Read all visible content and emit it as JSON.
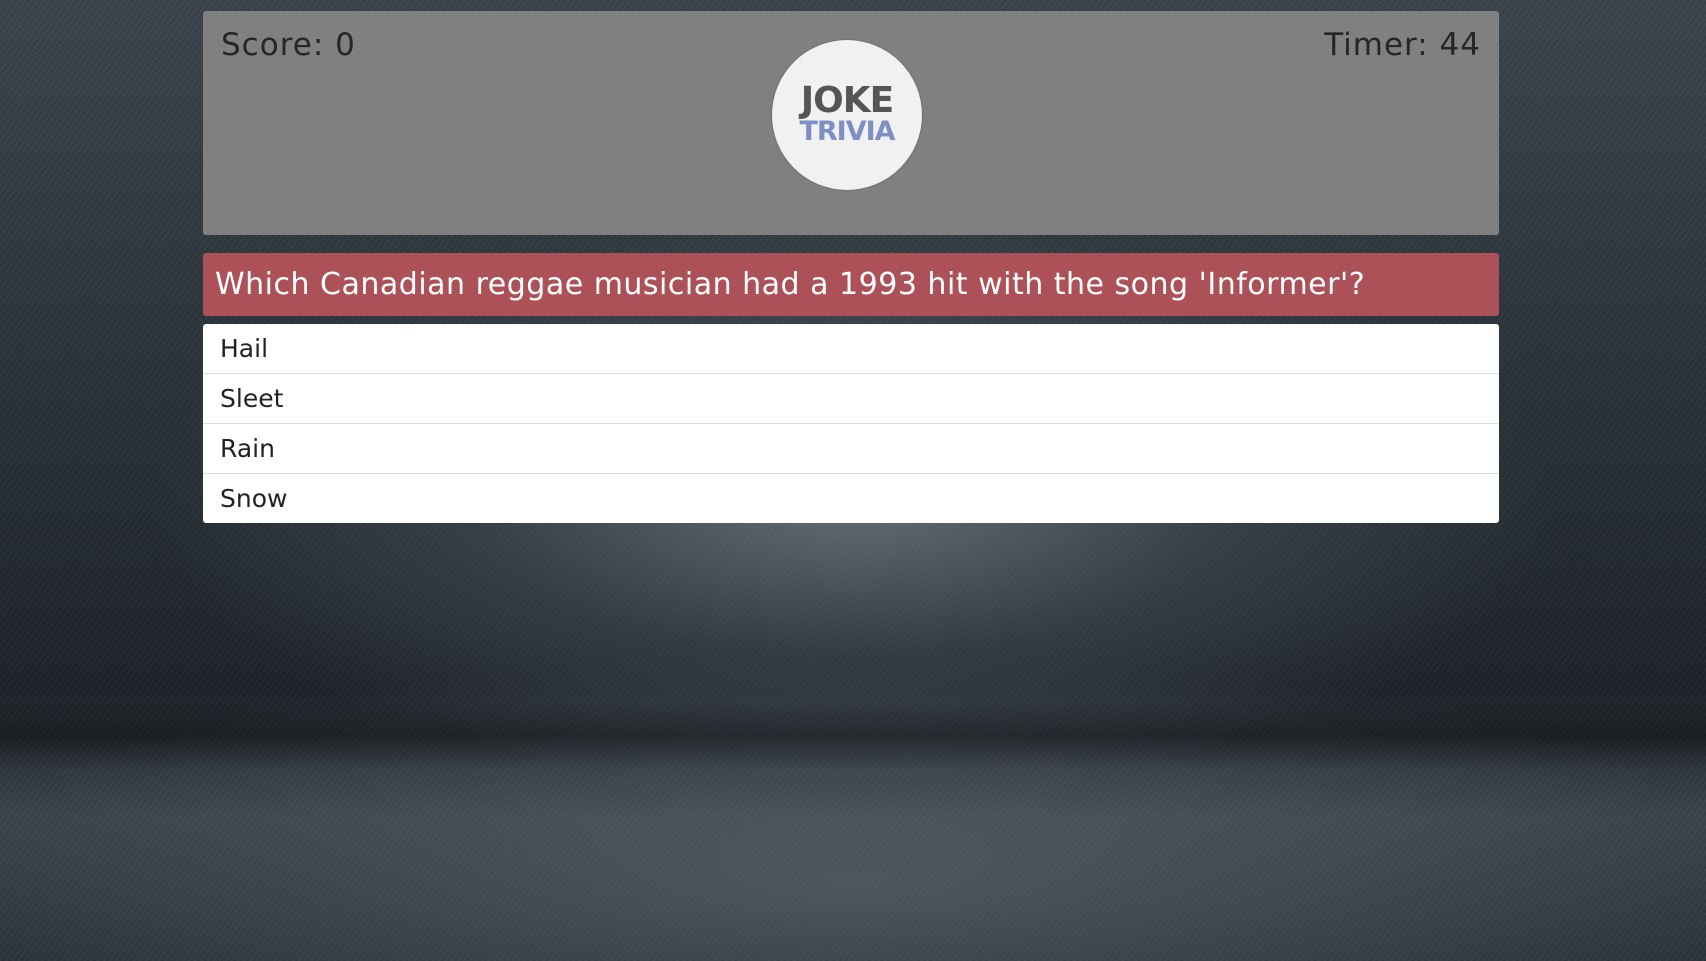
{
  "header": {
    "score_label": "Score: 0",
    "timer_label": "Timer: 44",
    "logo": {
      "line1": "JOKE",
      "line2": "TRIVIA",
      "colors": {
        "line1": "#555555",
        "line2": "#7f8fc6",
        "background": "#f1f1f1"
      }
    },
    "background_color": "#808080"
  },
  "question": {
    "text": "Which Canadian reggae musician had a 1993 hit with the song 'Informer'?",
    "background_color": "#ad5158"
  },
  "answers": [
    {
      "label": "Hail"
    },
    {
      "label": "Sleet"
    },
    {
      "label": "Rain"
    },
    {
      "label": "Snow"
    }
  ]
}
